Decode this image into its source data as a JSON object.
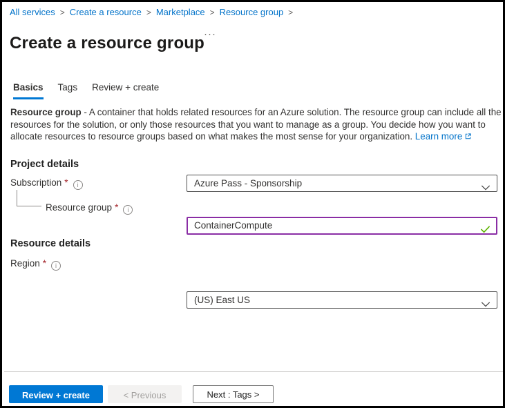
{
  "breadcrumb": {
    "separator": ">",
    "items": [
      "All services",
      "Create a resource",
      "Marketplace",
      "Resource group"
    ]
  },
  "header": {
    "title": "Create a resource group"
  },
  "tabs": [
    {
      "label": "Basics",
      "active": true
    },
    {
      "label": "Tags",
      "active": false
    },
    {
      "label": "Review + create",
      "active": false
    }
  ],
  "description": {
    "bold": "Resource group",
    "line1_rest": " - A container that holds related resources for an Azure solution. The resource group can include all the",
    "line2": "resources for the solution, or only those resources that you want to manage as a group. You decide how you want to",
    "line3": "allocate resources to resource groups based on what makes the most sense for your organization.",
    "learn_more": "Learn more"
  },
  "sections": {
    "project_details": {
      "heading": "Project details",
      "subscription": {
        "label": "Subscription",
        "required": "*",
        "value": "Azure Pass - Sponsorship"
      },
      "resource_group": {
        "label": "Resource group",
        "required": "*",
        "value": "ContainerCompute",
        "valid": true
      }
    },
    "resource_details": {
      "heading": "Resource details",
      "region": {
        "label": "Region",
        "required": "*",
        "value": "(US) East US"
      }
    }
  },
  "footer": {
    "review_create": "Review + create",
    "previous": "< Previous",
    "next": "Next : Tags >"
  },
  "icons": {
    "info": "i",
    "ellipsis": "···",
    "chevron_down": "v-chevron",
    "checkmark": "check",
    "external_link": "box-arrow"
  },
  "colors": {
    "accent": "#0078d4",
    "link": "#0072c9",
    "valid_border": "#8a2da5",
    "success": "#5db300",
    "required": "#a4262c"
  }
}
